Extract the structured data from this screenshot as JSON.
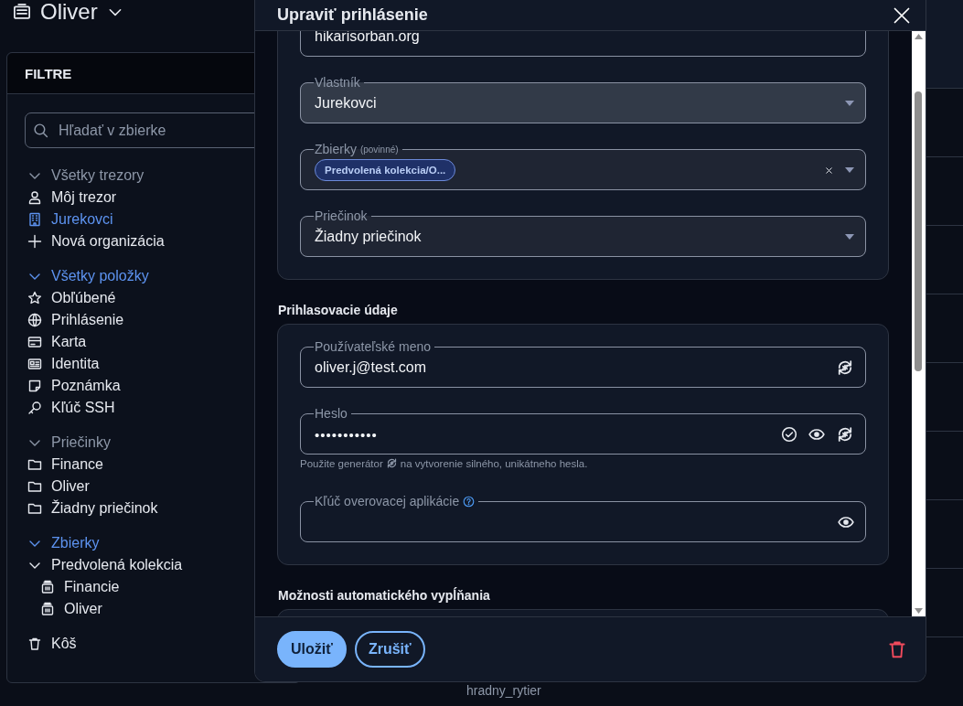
{
  "vault_header": {
    "title": "Oliver"
  },
  "filters": {
    "title": "FILTRE",
    "search": {
      "placeholder": "Hľadať v zbierke"
    },
    "groups": [
      {
        "label": "Všetky trezory",
        "expanded": true,
        "selected": false,
        "items": [
          {
            "kind": "vault",
            "label": "Môj trezor",
            "selected": false
          },
          {
            "kind": "organization",
            "label": "Jurekovci",
            "selected": true
          },
          {
            "kind": "add",
            "label": "Nová organizácia",
            "selected": false
          }
        ]
      },
      {
        "label": "Všetky položky",
        "expanded": true,
        "selected": true,
        "items": [
          {
            "kind": "favorites",
            "label": "Obľúbené",
            "selected": false
          },
          {
            "kind": "login",
            "label": "Prihlásenie",
            "selected": false
          },
          {
            "kind": "card",
            "label": "Karta",
            "selected": false
          },
          {
            "kind": "identity",
            "label": "Identita",
            "selected": false
          },
          {
            "kind": "note",
            "label": "Poznámka",
            "selected": false
          },
          {
            "kind": "ssh_key",
            "label": "Kľúč SSH",
            "selected": false
          }
        ]
      },
      {
        "label": "Priečinky",
        "expanded": true,
        "selected": false,
        "items": [
          {
            "kind": "folder",
            "label": "Finance",
            "selected": false
          },
          {
            "kind": "folder",
            "label": "Oliver",
            "selected": false
          },
          {
            "kind": "folder",
            "label": "Žiadny priečinok",
            "selected": false
          }
        ]
      },
      {
        "label": "Zbierky",
        "expanded": true,
        "selected": true,
        "items": [
          {
            "kind": "collection_group",
            "label": "Predvolená kolekcia",
            "selected": false,
            "expanded": true,
            "children": [
              {
                "kind": "collection",
                "label": "Financie",
                "selected": false
              },
              {
                "kind": "collection",
                "label": "Oliver",
                "selected": false
              }
            ]
          }
        ]
      }
    ],
    "trash": {
      "label": "Kôš",
      "selected": false
    }
  },
  "list": {
    "row_text": "hradny_rytier"
  },
  "dialog": {
    "title": "Upraviť prihlásenie",
    "sections": [
      {
        "fields": [
          {
            "kind": "uri",
            "value": "hikarisorban.org"
          },
          {
            "kind": "owner",
            "label": "Vlastník",
            "value": "Jurekovci"
          },
          {
            "kind": "collections",
            "label": "Zbierky",
            "note": "(povinné)",
            "chips": [
              "Predvolená kolekcia/O..."
            ]
          },
          {
            "kind": "folder",
            "label": "Priečinok",
            "value": "Žiadny priečinok"
          }
        ]
      },
      {
        "heading": "Prihlasovacie údaje",
        "fields": [
          {
            "kind": "username",
            "label": "Používateľské meno",
            "value": "oliver.j@test.com"
          },
          {
            "kind": "password",
            "label": "Heslo",
            "value": "•••••••••••",
            "hint": [
              "Použite generátor",
              "na vytvorenie silného, unikátneho hesla."
            ]
          },
          {
            "kind": "totp",
            "label": "Kľúč overovacej aplikácie"
          }
        ]
      },
      {
        "heading": "Možnosti automatického vypĺňania"
      }
    ],
    "buttons": [
      {
        "kind": "primary",
        "label": "Uložiť"
      },
      {
        "kind": "secondary",
        "label": "Zrušiť"
      }
    ]
  }
}
